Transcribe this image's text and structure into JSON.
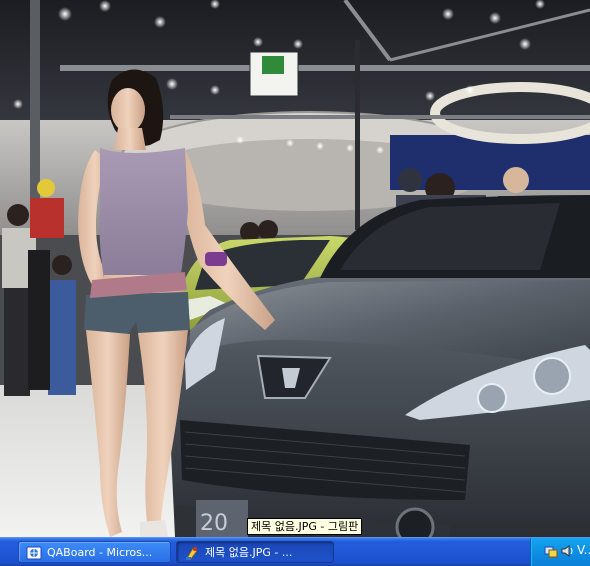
{
  "photo": {
    "description_icon": "photo-image",
    "plate_text": "20"
  },
  "tooltip": {
    "text": "제목 없음.JPG - 그림판"
  },
  "taskbar": {
    "buttons": [
      {
        "label": "QABoard - Micros...",
        "icon": "browser-icon",
        "active": false
      },
      {
        "label": "제목 없음.JPG - ...",
        "icon": "paint-icon",
        "active": true
      }
    ],
    "tray": {
      "icons": [
        "network-icon",
        "volume-icon"
      ],
      "clock_partial": "V..."
    }
  },
  "colors": {
    "taskbar_blue": "#245edb",
    "tray_blue": "#0f8fe3",
    "tooltip_bg": "#ffffe1"
  }
}
